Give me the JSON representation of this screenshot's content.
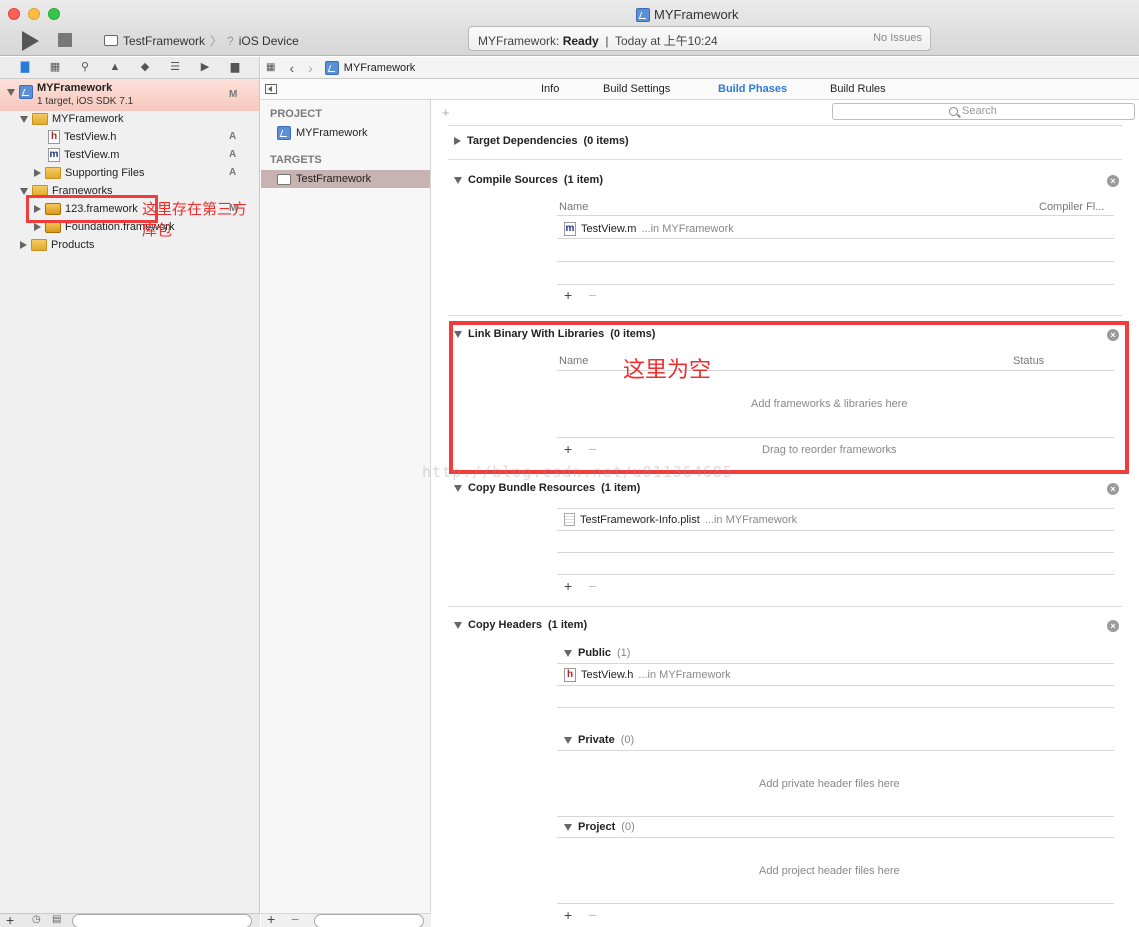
{
  "window": {
    "title": "MYFramework"
  },
  "toolbar": {
    "scheme_name": "TestFramework",
    "scheme_separator": "〉",
    "device_glyph": "?",
    "device": "iOS Device",
    "status_name": "MYFramework:",
    "status_state": "Ready",
    "status_divider": "|",
    "status_time": "Today at 上午10:24",
    "issues": "No Issues"
  },
  "navigator": {
    "project_name": "MYFramework",
    "project_subtitle": "1 target, iOS SDK 7.1",
    "project_badge": "M",
    "items": [
      {
        "label": "MYFramework",
        "badge": ""
      },
      {
        "label": "TestView.h",
        "badge": "A"
      },
      {
        "label": "TestView.m",
        "badge": "A"
      },
      {
        "label": "Supporting Files",
        "badge": "A"
      },
      {
        "label": "Frameworks",
        "badge": ""
      },
      {
        "label": "123.framework",
        "badge": "M"
      },
      {
        "label": "Foundation.framework",
        "badge": ""
      },
      {
        "label": "Products",
        "badge": ""
      }
    ]
  },
  "annotations": {
    "framework_note": "这里存在第三方库包",
    "empty_note": "这里为空",
    "watermark": "http://blog.csdn.net/u011364685"
  },
  "jumpbar": {
    "crumb": "MYFramework"
  },
  "editor_tabs": [
    "Info",
    "Build Settings",
    "Build Phases",
    "Build Rules"
  ],
  "editor_tabs_active": "Build Phases",
  "targets_panel": {
    "project_header": "PROJECT",
    "project_item": "MYFramework",
    "targets_header": "TARGETS",
    "target_item": "TestFramework"
  },
  "phases": {
    "add_symbol": "+",
    "search_placeholder": "Search",
    "close_symbol": "×",
    "plus": "+",
    "minus": "−",
    "target_dependencies": {
      "title": "Target Dependencies",
      "count": "(0 items)"
    },
    "compile_sources": {
      "title": "Compile Sources",
      "count": "(1 item)",
      "col_name": "Name",
      "col_flags": "Compiler Fl...",
      "rows": [
        {
          "file": "TestView.m",
          "location": "...in MYFramework"
        }
      ]
    },
    "link_binary": {
      "title": "Link Binary With Libraries",
      "count": "(0 items)",
      "col_name": "Name",
      "col_status": "Status",
      "empty_hint": "Add frameworks & libraries here",
      "drag_hint": "Drag to reorder frameworks"
    },
    "copy_bundle": {
      "title": "Copy Bundle Resources",
      "count": "(1 item)",
      "rows": [
        {
          "file": "TestFramework-Info.plist",
          "location": "...in MYFramework"
        }
      ]
    },
    "copy_headers": {
      "title": "Copy Headers",
      "count": "(1 item)",
      "public_label": "Public",
      "public_count": "(1)",
      "public_rows": [
        {
          "file": "TestView.h",
          "location": "...in MYFramework"
        }
      ],
      "private_label": "Private",
      "private_count": "(0)",
      "private_hint": "Add private header files here",
      "project_label": "Project",
      "project_count": "(0)",
      "project_hint": "Add project header files here"
    }
  },
  "colors": {
    "accent": "#2d7bd8",
    "annotation_red": "#f23b3b",
    "selection": "#c8b3b3"
  }
}
